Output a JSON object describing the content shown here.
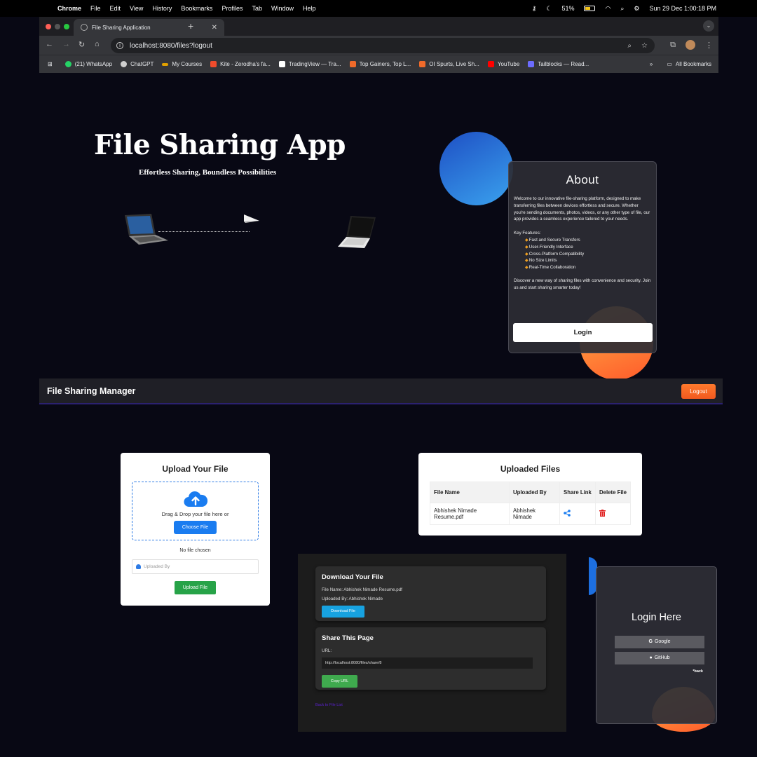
{
  "menubar": {
    "app": "Chrome",
    "items": [
      "File",
      "Edit",
      "View",
      "History",
      "Bookmarks",
      "Profiles",
      "Tab",
      "Window",
      "Help"
    ],
    "battery": "51%",
    "datetime": "Sun 29 Dec  1:00:18 PM"
  },
  "browser": {
    "tab_title": "File Sharing Application",
    "url": "localhost:8080/files?logout",
    "bookmarks": [
      {
        "label": "(21) WhatsApp",
        "color": "#25d366"
      },
      {
        "label": "ChatGPT",
        "color": "#cfcfcf"
      },
      {
        "label": "My Courses",
        "color": "#e0a000"
      },
      {
        "label": "Kite - Zerodha's fa...",
        "color": "#f04c2c"
      },
      {
        "label": "TradingView — Tra...",
        "color": "#ffffff"
      },
      {
        "label": "Top Gainers, Top L...",
        "color": "#f06a2a"
      },
      {
        "label": "OI Spurts, Live Sh...",
        "color": "#f06a2a"
      },
      {
        "label": "YouTube",
        "color": "#ff0000"
      },
      {
        "label": "Tailblocks — Read...",
        "color": "#6c6cff"
      }
    ],
    "all_bookmarks": "All Bookmarks"
  },
  "hero": {
    "title": "File Sharing App",
    "subtitle": "Effortless Sharing, Boundless Possibilities"
  },
  "about": {
    "title": "About",
    "intro": "Welcome to our innovative file-sharing platform, designed to make transferring files between devices effortless and secure. Whether you're sending documents, photos, videos, or any other type of file, our app provides a seamless experience tailored to your needs.",
    "key_features_label": "Key Features:",
    "features": [
      "Fast and Secure Transfers",
      "User-Friendly Interface",
      "Cross-Platform Compatibility",
      "No Size Limits",
      "Real-Time Collaboration"
    ],
    "outro": "Discover a new way of sharing files with convenience and security. Join us and start sharing smarter today!",
    "login_label": "Login"
  },
  "manager": {
    "title": "File Sharing Manager",
    "logout_label": "Logout"
  },
  "upload": {
    "title": "Upload Your File",
    "drag_text": "Drag & Drop your file here or",
    "choose_label": "Choose File",
    "no_file_text": "No file chosen",
    "uploaded_by_placeholder": "Uploaded By",
    "upload_label": "Upload File"
  },
  "files": {
    "title": "Uploaded Files",
    "headers": [
      "File Name",
      "Uploaded By",
      "Share Link",
      "Delete File"
    ],
    "rows": [
      {
        "file_name": "Abhishek Nimade Resume.pdf",
        "uploaded_by": "Abhishek Nimade"
      }
    ]
  },
  "download": {
    "title": "Download Your File",
    "file_name_line": "File Name: Abhishek Nimade Resume.pdf",
    "uploaded_by_line": "Uploaded By: Abhishek Nimade",
    "download_label": "Download File",
    "share_title": "Share This Page",
    "url_label": "URL:",
    "share_url": "http://localhost:8080/files/share/8",
    "copy_label": "Copy URL",
    "back_label": "Back to File List"
  },
  "login_here": {
    "title": "Login Here",
    "google_label": "Google",
    "github_label": "GitHub",
    "back_label": "*back"
  }
}
